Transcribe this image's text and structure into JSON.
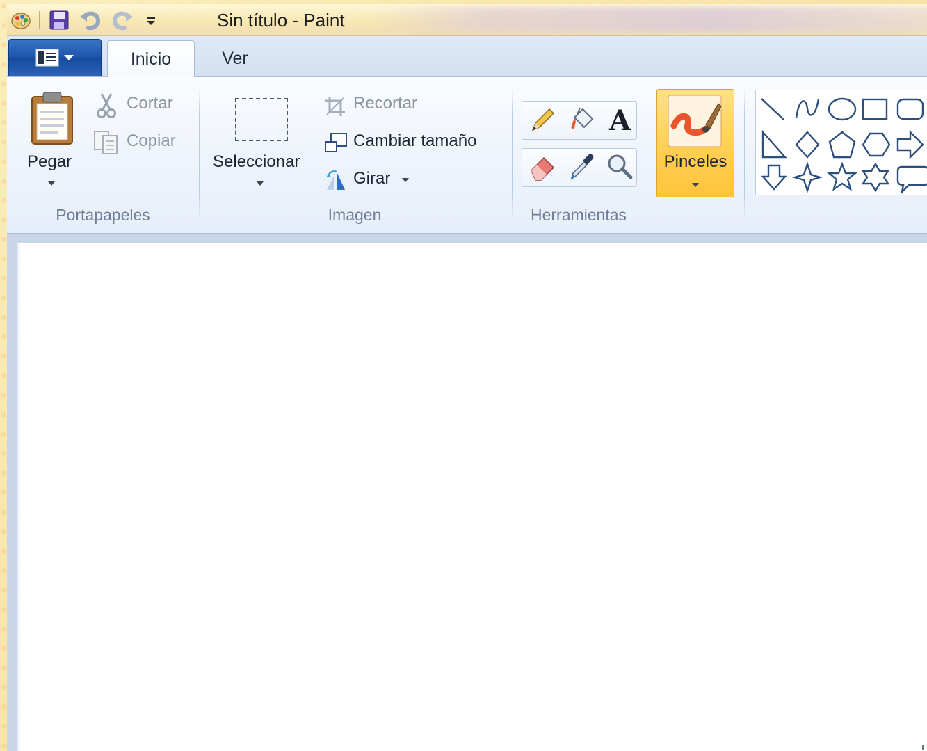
{
  "window": {
    "title": "Sin título - Paint"
  },
  "quick_access": {
    "icons": [
      "paint-app-icon",
      "save-icon",
      "undo-icon",
      "redo-icon",
      "customize-qat-icon"
    ]
  },
  "tabs": [
    {
      "label": "Inicio",
      "active": true
    },
    {
      "label": "Ver",
      "active": false
    }
  ],
  "groups": {
    "portapapeles": {
      "label": "Portapapeles",
      "paste": "Pegar",
      "cut": "Cortar",
      "copy": "Copiar"
    },
    "imagen": {
      "label": "Imagen",
      "select": "Seleccionar",
      "crop": "Recortar",
      "resize": "Cambiar tamaño",
      "rotate": "Girar"
    },
    "herramientas": {
      "label": "Herramientas",
      "tools": [
        "pencil",
        "fill",
        "text",
        "eraser",
        "color-picker",
        "magnifier"
      ]
    },
    "pinceles": {
      "label": "Pinceles"
    },
    "formas": {
      "shapes": [
        "line",
        "curve",
        "oval",
        "rectangle",
        "rounded-rectangle",
        "right-triangle",
        "diamond",
        "pentagon",
        "hexagon",
        "right-arrow",
        "down-arrow",
        "four-point-star",
        "five-point-star",
        "six-point-star",
        "callout"
      ]
    }
  },
  "colors": {
    "ribbon_bg": "#eef3fb",
    "active_button": "#ffd25a",
    "tab_bar": "#d4e1f1",
    "workspace": "#c8d6e8",
    "canvas": "#ffffff",
    "app_button": "#1d56ad"
  }
}
